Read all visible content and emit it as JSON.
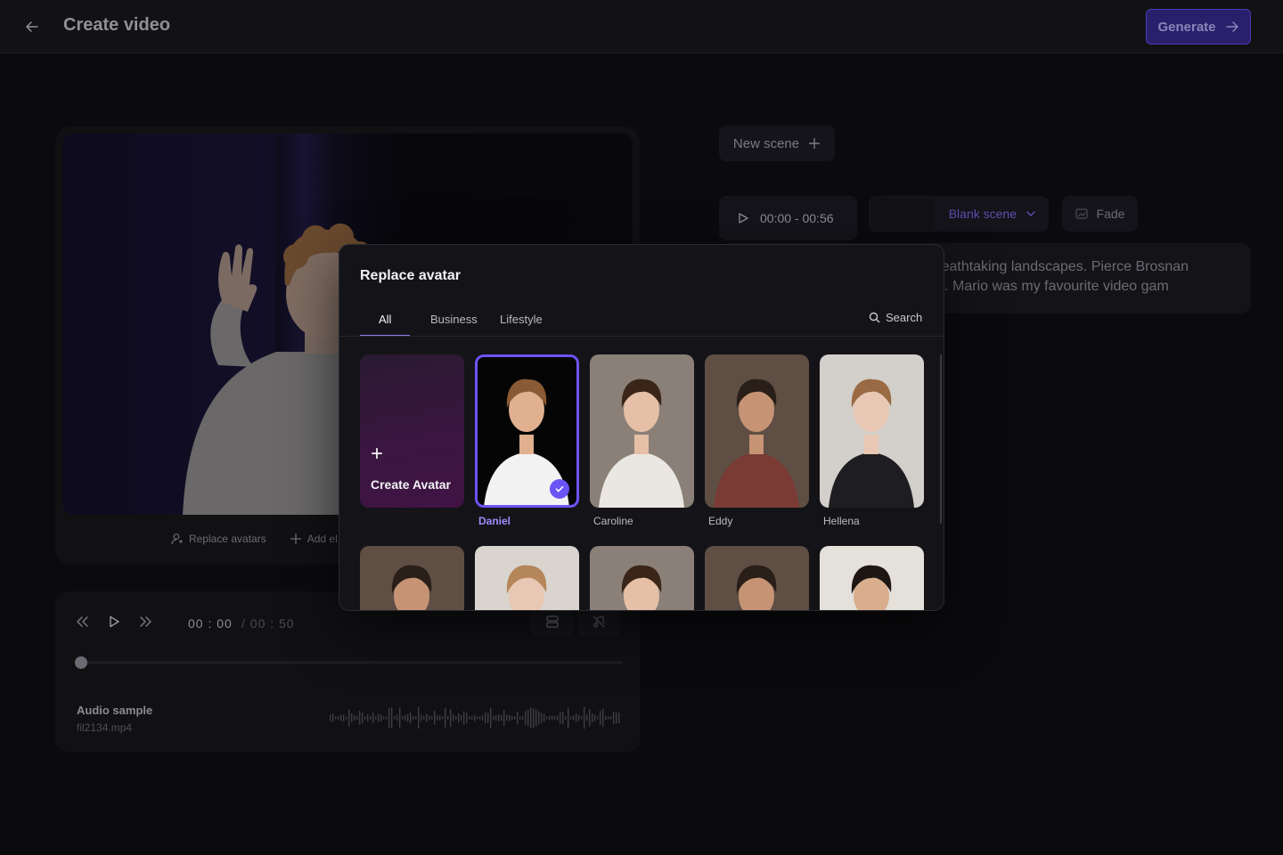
{
  "header": {
    "title": "Create video",
    "generate_label": "Generate"
  },
  "preview": {
    "replace_avatars_label": "Replace avatars",
    "add_element_label": "Add el"
  },
  "player": {
    "current_time": "00 : 00",
    "total_time": "/  00 : 50",
    "progress": 0,
    "audio": {
      "name": "Audio sample",
      "file": "fil2134.mp4"
    }
  },
  "scene": {
    "new_scene_label": "New scene",
    "time_range": "00:00 - 00:56",
    "background_select": "Blank scene",
    "transition_label": "Fade",
    "script_text": "d breathtaking landscapes. Pierce Brosnan\nears. Mario was my favourite video gam"
  },
  "modal": {
    "title": "Replace avatar",
    "tabs": [
      "All",
      "Business",
      "Lifestyle"
    ],
    "active_tab": "All",
    "search_label": "Search",
    "create_avatar_label": "Create Avatar",
    "avatars": [
      {
        "name": "Daniel",
        "selected": true,
        "bg": "#050505",
        "skin": "#e0b08f",
        "hair": "#8a5a34",
        "top": "#f2f2f2"
      },
      {
        "name": "Caroline",
        "selected": false,
        "bg": "#8a8078",
        "skin": "#e6c0a6",
        "hair": "#3a2518",
        "top": "#eae6e1"
      },
      {
        "name": "Eddy",
        "selected": false,
        "bg": "#5e4e44",
        "skin": "#c69474",
        "hair": "#2a1e18",
        "top": "#7a3b34"
      },
      {
        "name": "Hellena",
        "selected": false,
        "bg": "#d3cfca",
        "skin": "#e8c8b4",
        "hair": "#9a6a44",
        "top": "#1e1e22"
      }
    ],
    "avatars_row2": [
      {
        "bg": "#5e4e44",
        "skin": "#c69474",
        "hair": "#2a1e18"
      },
      {
        "bg": "#d9d4ce",
        "skin": "#e8c8b4",
        "hair": "#b4865a"
      },
      {
        "bg": "#8a8078",
        "skin": "#e6c0a6",
        "hair": "#3a2518"
      },
      {
        "bg": "#5e4e44",
        "skin": "#c69474",
        "hair": "#2a1e18"
      },
      {
        "bg": "#e4e0da",
        "skin": "#d8ae8e",
        "hair": "#1e1612"
      }
    ]
  },
  "colors": {
    "accent": "#6b54f5",
    "accent_text": "#9d8cff",
    "background": "#0b0b0e"
  }
}
